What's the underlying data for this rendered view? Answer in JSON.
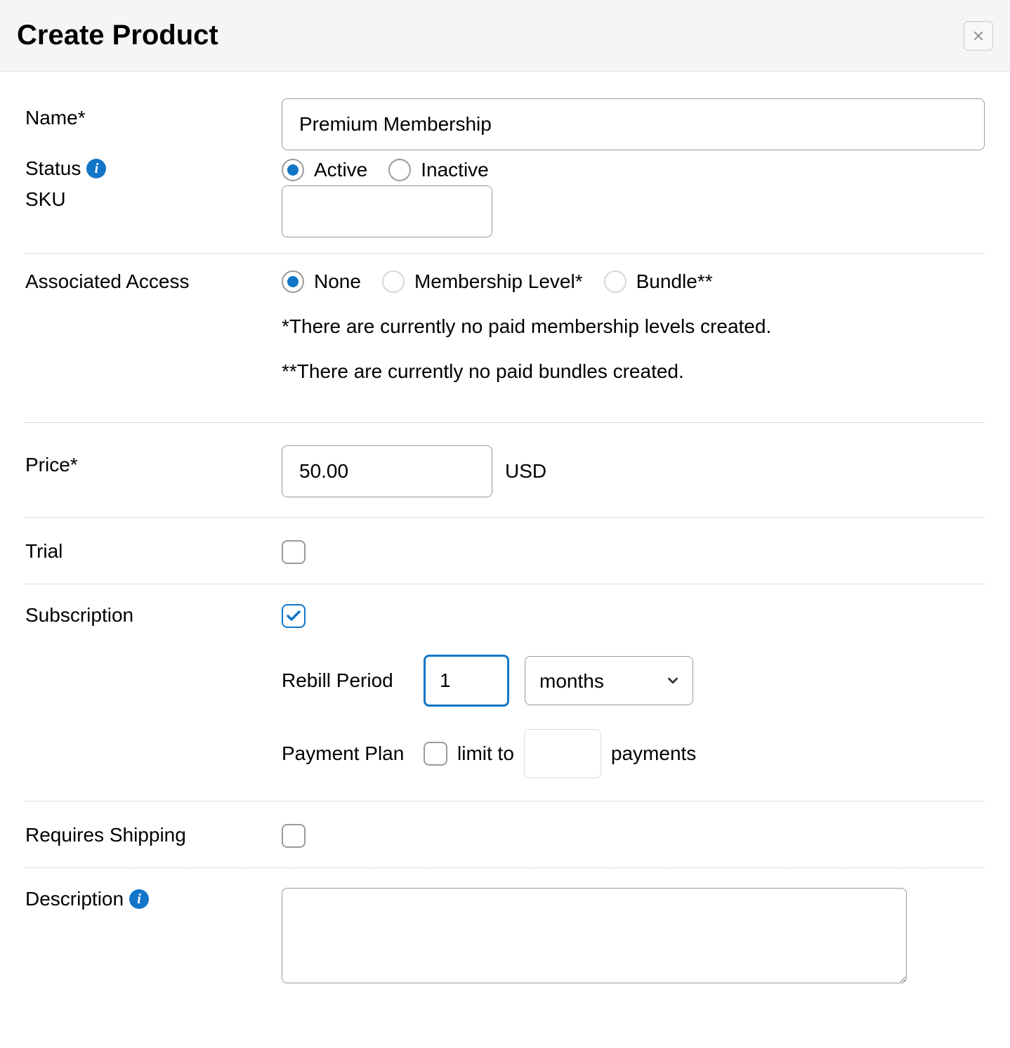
{
  "header": {
    "title": "Create Product"
  },
  "labels": {
    "name": "Name*",
    "status": "Status",
    "sku": "SKU",
    "associated_access": "Associated Access",
    "price": "Price*",
    "trial": "Trial",
    "subscription": "Subscription",
    "rebill_period": "Rebill Period",
    "payment_plan": "Payment Plan",
    "requires_shipping": "Requires Shipping",
    "description": "Description"
  },
  "fields": {
    "name": "Premium Membership",
    "sku": "",
    "price": "50.00",
    "currency": "USD",
    "rebill_value": "1",
    "rebill_unit": "months",
    "payment_limit_value": "",
    "description_value": ""
  },
  "status_options": {
    "active": "Active",
    "inactive": "Inactive"
  },
  "access_options": {
    "none": "None",
    "membership": "Membership Level*",
    "bundle": "Bundle**"
  },
  "notes": {
    "membership": "*There are currently no paid membership levels created.",
    "bundle": "**There are currently no paid bundles created."
  },
  "payment_plan": {
    "limit_to": "limit to",
    "payments": "payments"
  }
}
